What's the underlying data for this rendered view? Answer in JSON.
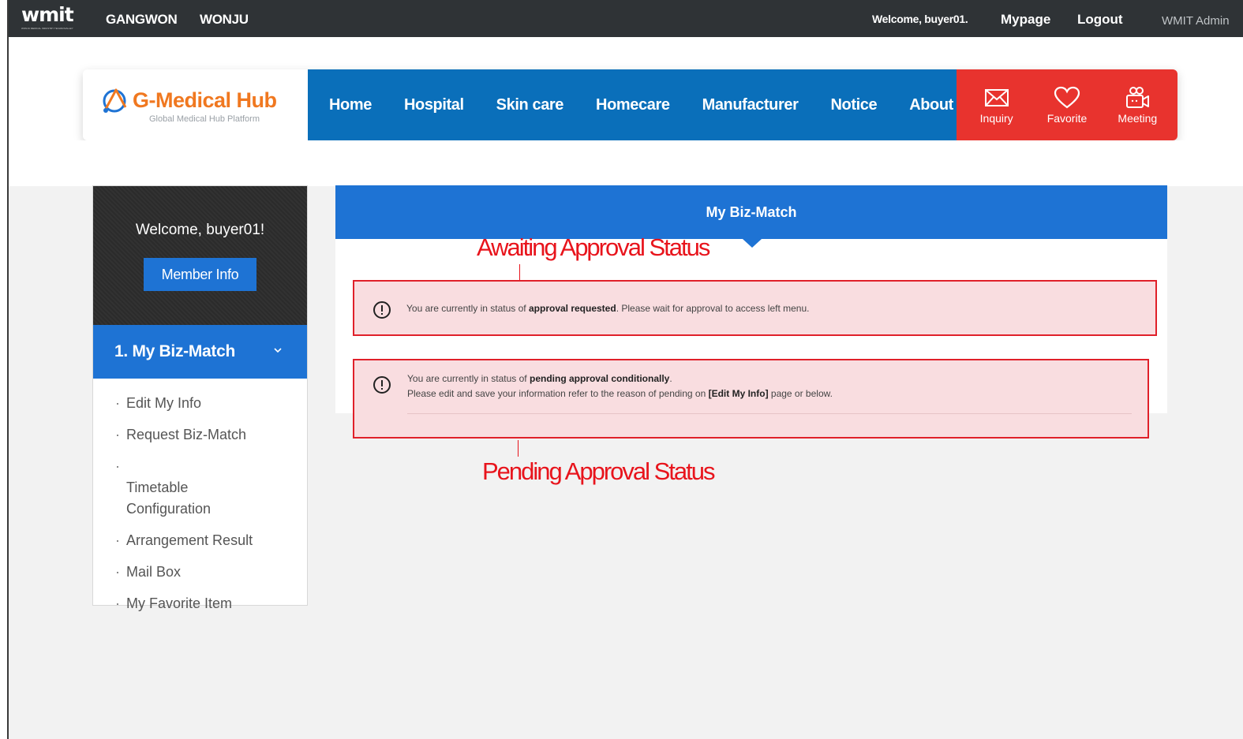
{
  "topbar": {
    "logo_text": "wmit",
    "logo_tagline": "WONJU MEDICAL INDUSTRY TECHNOVALLEY",
    "region_1": "GANGWON",
    "region_2": "WONJU",
    "welcome": "Welcome, buyer01.",
    "mypage": "Mypage",
    "logout": "Logout",
    "admin": "WMIT Admin"
  },
  "brand": {
    "name": "G-Medical Hub",
    "subtitle": "Global Medical Hub Platform"
  },
  "nav": [
    "Home",
    "Hospital",
    "Skin care",
    "Homecare",
    "Manufacturer",
    "Notice",
    "About"
  ],
  "quicklinks": [
    {
      "label": "Inquiry",
      "icon": "mail-icon"
    },
    {
      "label": "Favorite",
      "icon": "heart-icon"
    },
    {
      "label": "Meeting",
      "icon": "meeting-camera-icon"
    }
  ],
  "sidebar": {
    "welcome": "Welcome, buyer01!",
    "member_info": "Member Info",
    "section_title": "1. My Biz-Match",
    "items": [
      "Edit My Info",
      "Request Biz-Match",
      "Timetable\nConfiguration",
      "Arrangement Result",
      "Mail Box",
      "My Favorite Item"
    ]
  },
  "panel": {
    "title": "My Biz-Match"
  },
  "alerts": {
    "a1_pre": "You are currently in status of ",
    "a1_bold": "approval requested",
    "a1_post": ". Please wait for approval to access left menu.",
    "a2_pre": "You are currently in status of ",
    "a2_bold": "pending approval conditionally",
    "a2_post": ".",
    "a2_line2_pre": "Please edit and save your information refer to the reason of pending on ",
    "a2_line2_bold": "[Edit My Info]",
    "a2_line2_post": " page or below."
  },
  "annotations": {
    "awaiting": "Awaiting Approval Status",
    "pending": "Pending Approval Status"
  },
  "colors": {
    "topbar": "#2f3336",
    "nav_blue": "#0a6fba",
    "accent_blue": "#1e73d4",
    "quick_red": "#e8332e",
    "brand_orange": "#f07820",
    "alert_bg": "#f9dde0",
    "annotation_red": "#e8141c"
  }
}
